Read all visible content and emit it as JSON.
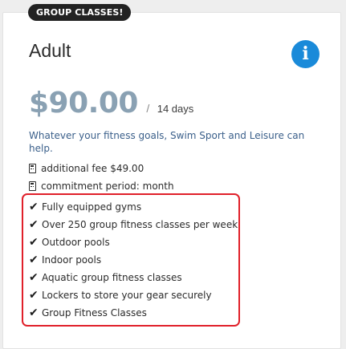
{
  "card": {
    "badge": "GROUP CLASSES!",
    "title": "Adult",
    "info_icon": "info-icon",
    "price": "$90.00",
    "price_separator": "/",
    "period": "14 days",
    "description": "Whatever your fitness goals, Swim Sport and Leisure can help.",
    "meta": [
      {
        "icon": "receipt-icon",
        "text": "additional fee $49.00"
      },
      {
        "icon": "receipt-icon",
        "text": "commitment period: month"
      }
    ],
    "features": [
      "Fully equipped gyms",
      "Over 250 group fitness classes per week",
      "Outdoor pools",
      "Indoor pools",
      "Aquatic group fitness classes",
      "Lockers to store your gear securely",
      "Group Fitness Classes"
    ],
    "check_glyph": "✔",
    "info_glyph": "i"
  },
  "colors": {
    "price": "#8aa1b3",
    "info_button": "#1a8ad9",
    "highlight_border": "#e0202a",
    "description": "#3a5f8a",
    "badge_bg": "#222222"
  }
}
